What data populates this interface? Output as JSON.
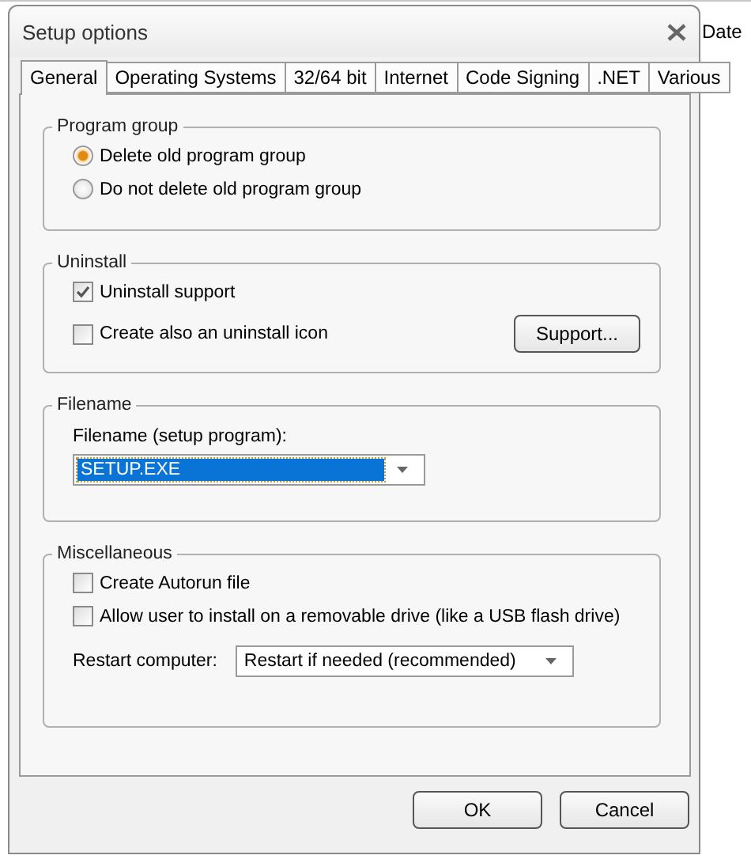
{
  "window": {
    "title": "Setup options"
  },
  "background_column": {
    "header": "Date"
  },
  "tabs": [
    {
      "label": "General",
      "selected": true
    },
    {
      "label": "Operating Systems",
      "selected": false
    },
    {
      "label": "32/64 bit",
      "selected": false
    },
    {
      "label": "Internet",
      "selected": false
    },
    {
      "label": "Code Signing",
      "selected": false
    },
    {
      "label": ".NET",
      "selected": false
    },
    {
      "label": "Various",
      "selected": false
    }
  ],
  "groups": [
    {
      "title": "Program group",
      "items": [
        {
          "kind": "radio",
          "label": "Delete old program group",
          "selected": true
        },
        {
          "kind": "radio",
          "label": "Do not delete old program group",
          "selected": false
        }
      ]
    },
    {
      "title": "Uninstall",
      "items": [
        {
          "kind": "checkbox",
          "label": "Uninstall support",
          "checked": true
        },
        {
          "kind": "checkbox-button",
          "label": "Create also an uninstall icon",
          "checked": false,
          "button": "Support..."
        }
      ]
    },
    {
      "title": "Filename",
      "items": [
        {
          "kind": "combo",
          "label": "Filename (setup program):",
          "value": "SETUP.EXE",
          "highlighted": true
        }
      ]
    },
    {
      "title": "Miscellaneous",
      "items": [
        {
          "kind": "checkbox",
          "label": "Create Autorun file",
          "checked": false
        },
        {
          "kind": "checkbox",
          "label": "Allow user to install on a removable drive (like a USB flash drive)",
          "checked": false
        },
        {
          "kind": "inline-combo",
          "label": "Restart computer:",
          "value": "Restart if needed (recommended)",
          "highlighted": false
        }
      ]
    }
  ],
  "buttons": [
    "OK",
    "Cancel"
  ]
}
